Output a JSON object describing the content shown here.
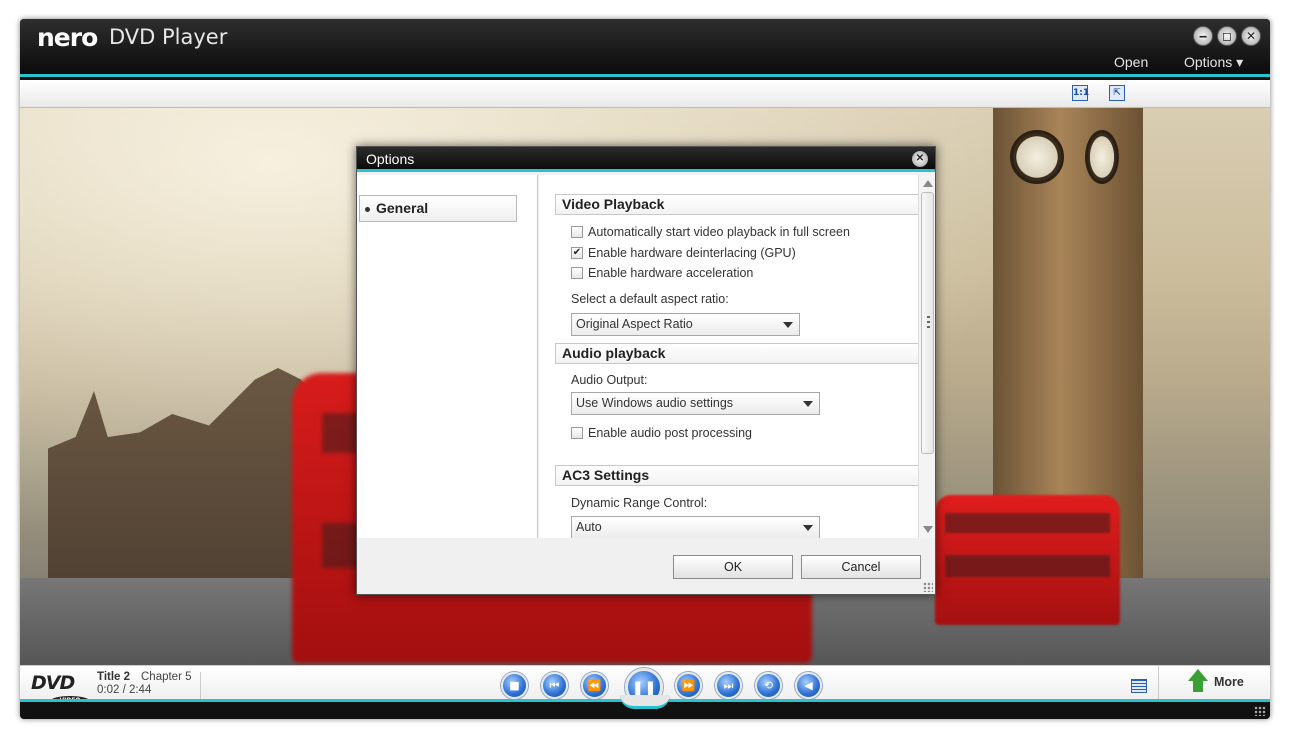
{
  "window": {
    "logo": "nero",
    "title": "DVD Player",
    "menu": {
      "open": "Open",
      "options": "Options ▾"
    },
    "window_buttons": {
      "minimize": "‒",
      "maximize": "◻",
      "close": "✕"
    }
  },
  "toolbar": {
    "ratio_label": "1:1",
    "fullscreen_icon": "⇱"
  },
  "dialog": {
    "title": "Options",
    "close_glyph": "✕",
    "nav": {
      "general": "General"
    },
    "sections": {
      "video": {
        "header": "Video Playback",
        "auto_fullscreen": "Automatically start video playback in full screen",
        "auto_fullscreen_checked": false,
        "hw_deinterlacing": "Enable hardware deinterlacing (GPU)",
        "hw_deinterlacing_checked": true,
        "hw_acceleration": "Enable hardware acceleration",
        "hw_acceleration_checked": false,
        "aspect_label": "Select a default aspect ratio:",
        "aspect_value": "Original Aspect Ratio"
      },
      "audio": {
        "header": "Audio playback",
        "output_label": "Audio Output:",
        "output_value": "Use Windows audio settings",
        "post_processing": "Enable audio post processing",
        "post_processing_checked": false
      },
      "ac3": {
        "header": "AC3 Settings",
        "drc_label": "Dynamic Range Control:",
        "drc_value": "Auto"
      }
    },
    "buttons": {
      "ok": "OK",
      "cancel": "Cancel"
    }
  },
  "playback": {
    "disc_logo": "DVD",
    "disc_sub": "VIDEO",
    "title": "Title 2",
    "chapter": "Chapter 5",
    "time": "0:02 / 2:44",
    "controls": {
      "stop": "■",
      "prev": "⏮",
      "rewind": "⏪",
      "pause": "❚❚",
      "forward": "⏩",
      "next": "⏭",
      "repeat": "⟲",
      "volume": "◀"
    },
    "more_label": "More"
  },
  "colors": {
    "accent": "#27c4cf",
    "control_blue": "#2a6fd1",
    "more_green": "#3aa035"
  }
}
